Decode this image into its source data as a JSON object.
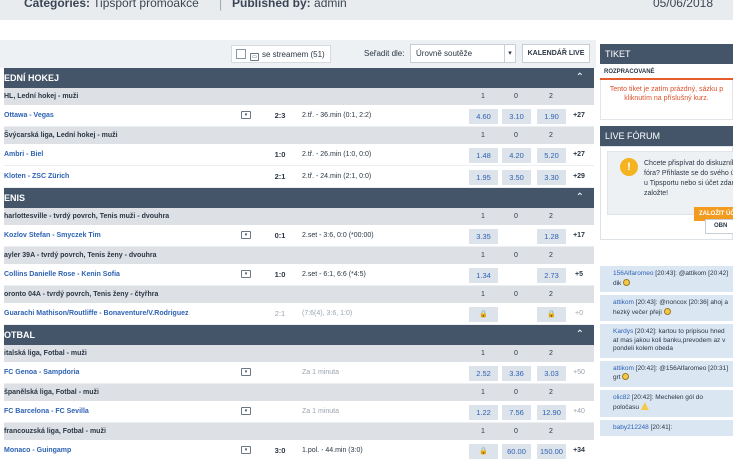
{
  "meta": {
    "categories_label": "Categories:",
    "categories_value": "Tipsport promoakce",
    "published_label": "Published by:",
    "published_value": "admin",
    "date": "05/06/2018"
  },
  "toolbar": {
    "stream_label": "se streamem (51)",
    "sort_label": "Seřadit dle:",
    "sort_value": "Úrovně soutěže",
    "calendar_label": "KALENDÁŘ LIVE"
  },
  "sports": [
    {
      "name": "EDNÍ HOKEJ",
      "groups": [
        {
          "league": "HL, Lední hokej - muži",
          "cols": [
            "1",
            "0",
            "2"
          ],
          "matches": [
            {
              "name": "Ottawa - Vegas",
              "tv": true,
              "score": "2:3",
              "info": "2.tř. - 36.min (0:1, 2:2)",
              "odds": [
                "4.60",
                "3.10",
                "1.90"
              ],
              "more": "+27"
            }
          ]
        },
        {
          "league": "Švýcarská liga, Lední hokej - muži",
          "cols": [
            "1",
            "0",
            "2"
          ],
          "matches": [
            {
              "name": "Ambri - Biel",
              "tv": false,
              "score": "1:0",
              "info": "2.tř. - 26.min (1:0, 0:0)",
              "odds": [
                "1.48",
                "4.20",
                "5.20"
              ],
              "more": "+27"
            },
            {
              "name": "Kloten - ZSC Zürich",
              "tv": false,
              "score": "2:1",
              "info": "2.tř. - 24.min (2:1, 0:0)",
              "odds": [
                "1.95",
                "3.50",
                "3.30"
              ],
              "more": "+29"
            }
          ]
        }
      ]
    },
    {
      "name": "ENIS",
      "groups": [
        {
          "league": "harlottesville - tvrdý povrch, Tenis muži - dvouhra",
          "cols": [
            "1",
            "0",
            "2"
          ],
          "matches": [
            {
              "name": "Kozlov Stefan - Smyczek Tim",
              "tv": true,
              "score": "0:1",
              "info": "2.set - 3:6, 0:0 (*00:00)",
              "odds": [
                "3.35",
                "",
                "1.28"
              ],
              "more": "+17"
            }
          ]
        },
        {
          "league": "ayler 39A - tvrdý povrch, Tenis ženy - dvouhra",
          "cols": [
            "1",
            "0",
            "2"
          ],
          "matches": [
            {
              "name": "Collins Danielle Rose - Kenin Sofia",
              "tv": true,
              "score": "1:0",
              "info": "2.set - 6:1, 6:6 (*4:5)",
              "odds": [
                "1.34",
                "",
                "2.73"
              ],
              "more": "+5"
            }
          ]
        },
        {
          "league": "oronto 04A - tvrdý povrch, Tenis ženy - čtyřhra",
          "cols": [
            "1",
            "0",
            "2"
          ],
          "matches": [
            {
              "name": "Guarachi Mathison/Routliffe - Bonaventure/V.Rodriguez",
              "tv": false,
              "score": "2:1",
              "info": "(7:6(4), 3:6, 1:0)",
              "odds": [
                "lock",
                "",
                "lock"
              ],
              "more": "+0",
              "dim": true
            }
          ]
        }
      ]
    },
    {
      "name": "OTBAL",
      "groups": [
        {
          "league": "italská liga, Fotbal - muži",
          "cols": [
            "1",
            "0",
            "2"
          ],
          "matches": [
            {
              "name": "FC Genoa - Sampdoria",
              "tv": true,
              "score": "",
              "info": "Za 1 minuta",
              "odds": [
                "2.52",
                "3.36",
                "3.03"
              ],
              "more": "+50",
              "dim": true
            }
          ]
        },
        {
          "league": "španělská liga, Fotbal - muži",
          "cols": [
            "1",
            "0",
            "2"
          ],
          "matches": [
            {
              "name": "FC Barcelona - FC Sevilla",
              "tv": true,
              "score": "",
              "info": "Za 1 minuta",
              "odds": [
                "1.22",
                "7.56",
                "12.90"
              ],
              "more": "+40",
              "dim": true
            }
          ]
        },
        {
          "league": "francouzská liga, Fotbal - muži",
          "cols": [
            "1",
            "0",
            "2"
          ],
          "matches": [
            {
              "name": "Monaco - Guingamp",
              "tv": true,
              "score": "3:0",
              "info": "1.pol. - 44.min (3:0)",
              "odds": [
                "lock",
                "60.00",
                "150.00"
              ],
              "more": "+34"
            }
          ]
        }
      ]
    }
  ],
  "side": {
    "tiket_title": "TIKET",
    "tiket_tab": "ROZPRACOVANÉ",
    "tiket_msg": "Tento tiket je zatím prázdný, sázku p kliknutím na příslušný kurz.",
    "forum_title": "LIVE FÓRUM",
    "forum_prompt": "Chcete přispívat do diskuzního fóra? Přihlaste se do svého účtu u Tipsportu nebo si účet zdarma založte!",
    "forum_register": "ZALOŽIT ÚČ",
    "forum_refresh": "OBN",
    "posts": [
      {
        "user": "156Alfaromeo",
        "time": "[20:43]:",
        "text": "@attikom [20:42] dik"
      },
      {
        "user": "attikom",
        "time": "[20:43]:",
        "text": "@noncox [20:36] ahoj a hezký večer přeji"
      },
      {
        "user": "Kardys",
        "time": "[20:42]:",
        "text": "kartou to pripisou hned at mas jakou koli banku,prevodem az v pondeli kolem obeda"
      },
      {
        "user": "attikom",
        "time": "[20:42]:",
        "text": "@156Alfaromeo [20:31] grt"
      },
      {
        "user": "olic82",
        "time": "[20:42]:",
        "text": "Mechelen gól do poločasu"
      },
      {
        "user": "baby212248",
        "time": "[20:41]:",
        "text": ""
      }
    ]
  }
}
